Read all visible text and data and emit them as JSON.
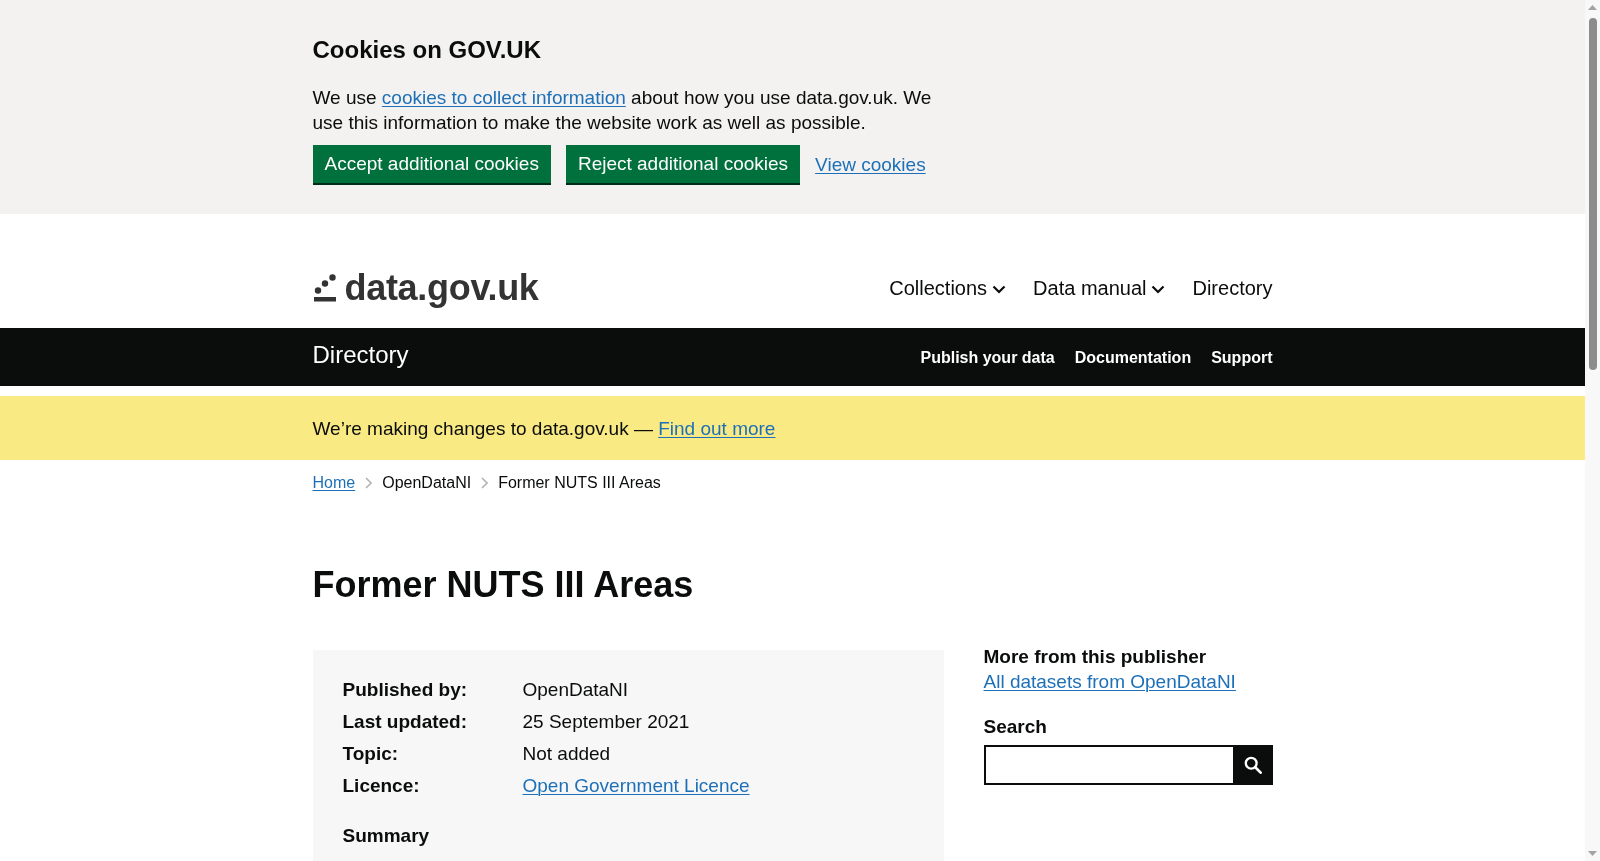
{
  "cookie_banner": {
    "title": "Cookies on GOV.UK",
    "message": {
      "before": "We use",
      "link": "cookies to collect information",
      "after": "about how you use data.gov.uk. We use this information to make the website work as well as possible."
    },
    "actions": [
      {
        "kind": "button",
        "label": "Accept additional cookies"
      },
      {
        "kind": "button",
        "label": "Reject additional cookies"
      },
      {
        "kind": "link",
        "label": "View cookies"
      }
    ]
  },
  "header": {
    "logo": "data.gov.uk",
    "nav": [
      {
        "label": "Collections",
        "dropdown": true
      },
      {
        "label": "Data manual",
        "dropdown": true
      },
      {
        "label": "Directory",
        "dropdown": false
      }
    ]
  },
  "service_bar": {
    "title": "Directory",
    "links": [
      "Publish your data",
      "Documentation",
      "Support"
    ]
  },
  "notice": {
    "text": "We’re making changes to data.gov.uk —",
    "link": "Find out more"
  },
  "breadcrumbs": [
    {
      "label": "Home",
      "link": true
    },
    {
      "label": "OpenDataNI",
      "link": false
    },
    {
      "label": "Former NUTS III Areas",
      "link": false
    }
  ],
  "page_title": "Former NUTS III Areas",
  "metadata": {
    "rows": [
      {
        "label": "Published by:",
        "value": "OpenDataNI",
        "kind": "text"
      },
      {
        "label": "Last updated:",
        "value": "25 September 2021",
        "kind": "text"
      },
      {
        "label": "Topic:",
        "value": "Not added",
        "kind": "text"
      },
      {
        "label": "Licence:",
        "value": "Open Government Licence",
        "kind": "link"
      }
    ],
    "summary_heading": "Summary"
  },
  "sidebar": {
    "publisher_heading": "More from this publisher",
    "publisher_link": "All datasets from OpenDataNI",
    "search_label": "Search"
  }
}
